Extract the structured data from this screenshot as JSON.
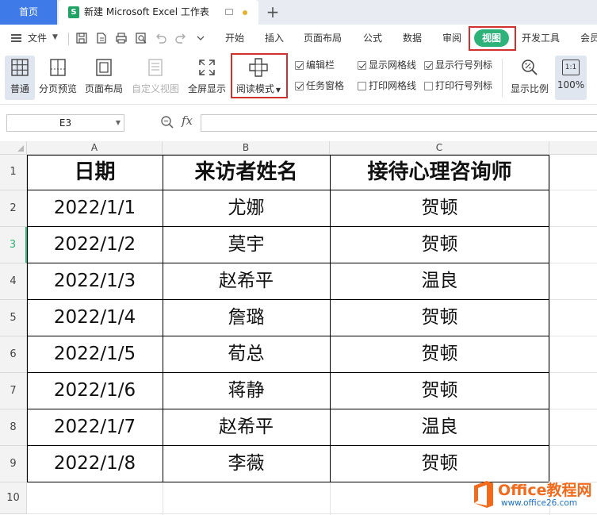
{
  "titlebar": {
    "home_tab": "首页",
    "doc_icon_letter": "S",
    "doc_title": "新建 Microsoft Excel 工作表",
    "new_tab": "+"
  },
  "menubar": {
    "file_label": "文件",
    "items": [
      "开始",
      "插入",
      "页面布局",
      "公式",
      "数据",
      "审阅",
      "视图",
      "开发工具",
      "会员"
    ],
    "active_item": "视图",
    "active_color": "#2db37a"
  },
  "ribbon": {
    "view_buttons": [
      "普通",
      "分页预览",
      "页面布局",
      "自定义视图",
      "全屏显示",
      "阅读模式"
    ],
    "checkboxes": [
      {
        "label": "编辑栏",
        "checked": true
      },
      {
        "label": "显示网格线",
        "checked": true
      },
      {
        "label": "显示行号列标",
        "checked": true
      },
      {
        "label": "任务窗格",
        "checked": true
      },
      {
        "label": "打印网格线",
        "checked": false
      },
      {
        "label": "打印行号列标",
        "checked": false
      }
    ],
    "zoom_label": "显示比例",
    "zoom_100_icon": "1:1",
    "zoom_100_label": "100%"
  },
  "formula_bar": {
    "cell_ref": "E3",
    "fx_label": "fx",
    "formula": ""
  },
  "sheet": {
    "columns": [
      "A",
      "B",
      "C"
    ],
    "row_numbers": [
      "1",
      "2",
      "3",
      "4",
      "5",
      "6",
      "7",
      "8",
      "9",
      "10"
    ],
    "selected_row": "3",
    "header": [
      "日期",
      "来访者姓名",
      "接待心理咨询师"
    ],
    "rows": [
      [
        "2022/1/1",
        "尤娜",
        "贺顿"
      ],
      [
        "2022/1/2",
        "莫宇",
        "贺顿"
      ],
      [
        "2022/1/3",
        "赵希平",
        "温良"
      ],
      [
        "2022/1/4",
        "詹璐",
        "贺顿"
      ],
      [
        "2022/1/5",
        "荀总",
        "贺顿"
      ],
      [
        "2022/1/6",
        "蒋静",
        "贺顿"
      ],
      [
        "2022/1/7",
        "赵希平",
        "温良"
      ],
      [
        "2022/1/8",
        "李薇",
        "贺顿"
      ]
    ]
  },
  "watermark": {
    "brand": "Office教程网",
    "url": "www.office26.com"
  },
  "colors": {
    "highlight_red": "#d0312d",
    "accent_blue": "#3f7be8",
    "excel_green": "#21a366"
  }
}
